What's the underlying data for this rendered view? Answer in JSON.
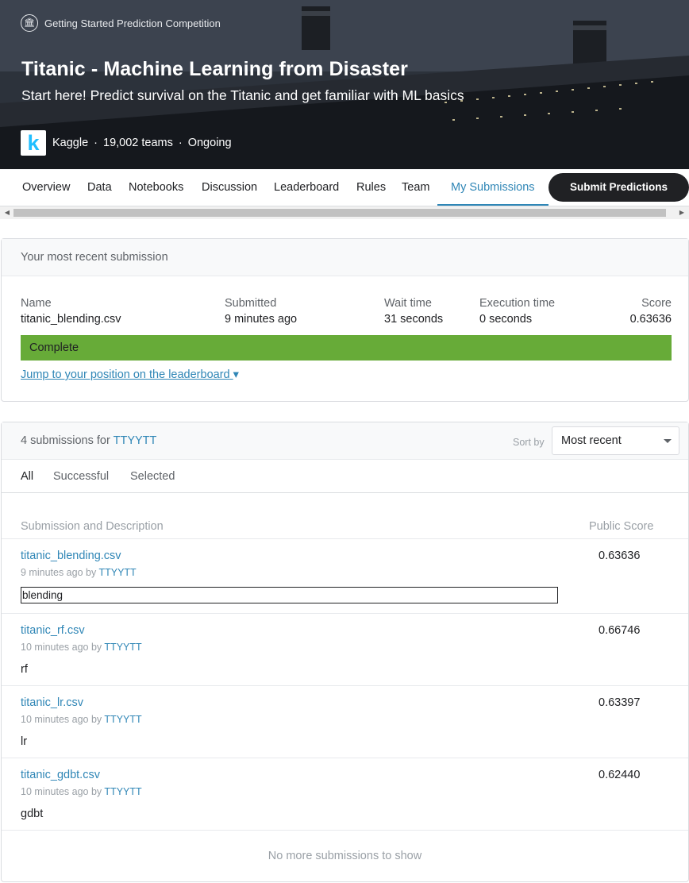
{
  "hero": {
    "kicker": "Getting Started Prediction Competition",
    "kicker_icon": "bank-icon",
    "title": "Titanic - Machine Learning from Disaster",
    "subtitle": "Start here! Predict survival on the Titanic and get familiar with ML basics",
    "logo_letter": "k",
    "host": "Kaggle",
    "teams": "19,002 teams",
    "status": "Ongoing",
    "separator": "·"
  },
  "tabs": [
    "Overview",
    "Data",
    "Notebooks",
    "Discussion",
    "Leaderboard",
    "Rules",
    "Team",
    "My Submissions"
  ],
  "active_tab": "My Submissions",
  "submit_label": "Submit Predictions",
  "recent": {
    "header": "Your most recent submission",
    "columns": [
      {
        "label": "Name",
        "value": "titanic_blending.csv"
      },
      {
        "label": "Submitted",
        "value": "9 minutes ago"
      },
      {
        "label": "Wait time",
        "value": "31 seconds"
      },
      {
        "label": "Execution time",
        "value": "0 seconds"
      },
      {
        "label": "Score",
        "value": "0.63636"
      }
    ],
    "status": "Complete",
    "status_color": "#67ab38",
    "jump_link": "Jump to your position on the leaderboard",
    "jump_caret": "▾"
  },
  "list": {
    "count_prefix": "4 submissions for",
    "team": "TTYYTT",
    "sort_label": "Sort by",
    "sort_value": "Most recent",
    "filters": [
      "All",
      "Successful",
      "Selected"
    ],
    "active_filter": "All",
    "col_desc": "Submission and Description",
    "col_score": "Public Score",
    "by_word": "by",
    "rows": [
      {
        "file": "titanic_blending.csv",
        "when": "9 minutes ago",
        "user": "TTYYTT",
        "desc": "blending",
        "score": "0.63636",
        "editing": true
      },
      {
        "file": "titanic_rf.csv",
        "when": "10 minutes ago",
        "user": "TTYYTT",
        "desc": "rf",
        "score": "0.66746",
        "editing": false
      },
      {
        "file": "titanic_lr.csv",
        "when": "10 minutes ago",
        "user": "TTYYTT",
        "desc": "lr",
        "score": "0.63397",
        "editing": false
      },
      {
        "file": "titanic_gdbt.csv",
        "when": "10 minutes ago",
        "user": "TTYYTT",
        "desc": "gdbt",
        "score": "0.62440",
        "editing": false
      }
    ],
    "footer": "No more submissions to show"
  },
  "accent_color": "#2f86b6"
}
